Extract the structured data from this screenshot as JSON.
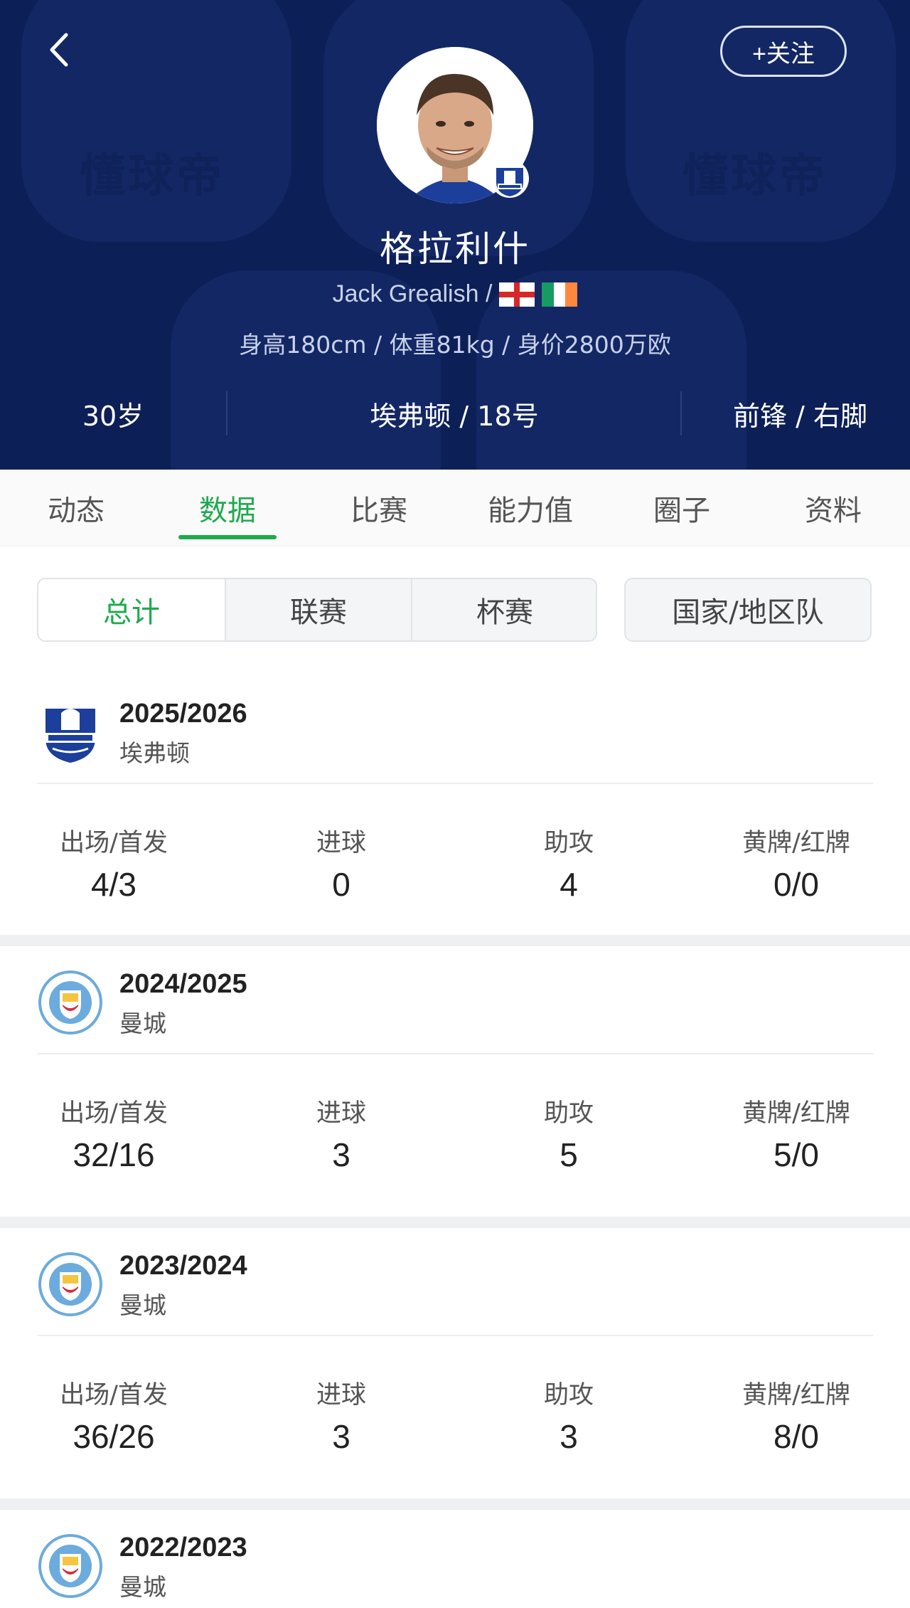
{
  "header": {
    "back_icon": "back-chevron-icon",
    "follow_label": "+关注",
    "watermark": "懂球帝",
    "player_name": "格拉利什",
    "english_name": "Jack Grealish /",
    "flags": [
      "england-flag-icon",
      "ireland-flag-icon"
    ],
    "meta": "身高180cm / 体重81kg / 身价2800万欧",
    "age": "30岁",
    "team_number": "埃弗顿 / 18号",
    "position_foot": "前锋 / 右脚"
  },
  "tabs": [
    {
      "label": "动态",
      "active": false
    },
    {
      "label": "数据",
      "active": true
    },
    {
      "label": "比赛",
      "active": false
    },
    {
      "label": "能力值",
      "active": false
    },
    {
      "label": "圈子",
      "active": false
    },
    {
      "label": "资料",
      "active": false
    }
  ],
  "segments": {
    "items": [
      "总计",
      "联赛",
      "杯赛"
    ],
    "active": "总计",
    "national": "国家/地区队"
  },
  "stat_labels": {
    "apps": "出场/首发",
    "goals": "进球",
    "assists": "助攻",
    "cards": "黄牌/红牌"
  },
  "seasons": [
    {
      "year": "2025/2026",
      "club": "埃弗顿",
      "badge": "everton-badge-icon",
      "apps": "4/3",
      "goals": "0",
      "assists": "4",
      "cards": "0/0"
    },
    {
      "year": "2024/2025",
      "club": "曼城",
      "badge": "man-city-badge-icon",
      "apps": "32/16",
      "goals": "3",
      "assists": "5",
      "cards": "5/0"
    },
    {
      "year": "2023/2024",
      "club": "曼城",
      "badge": "man-city-badge-icon",
      "apps": "36/26",
      "goals": "3",
      "assists": "3",
      "cards": "8/0"
    },
    {
      "year": "2022/2023",
      "club": "曼城",
      "badge": "man-city-badge-icon",
      "apps": "",
      "goals": "",
      "assists": "",
      "cards": ""
    }
  ],
  "colors": {
    "header_bg": "#0d1f57",
    "accent_green": "#1faa4d",
    "everton_blue": "#1b3f9a",
    "city_blue": "#6cabdd"
  }
}
